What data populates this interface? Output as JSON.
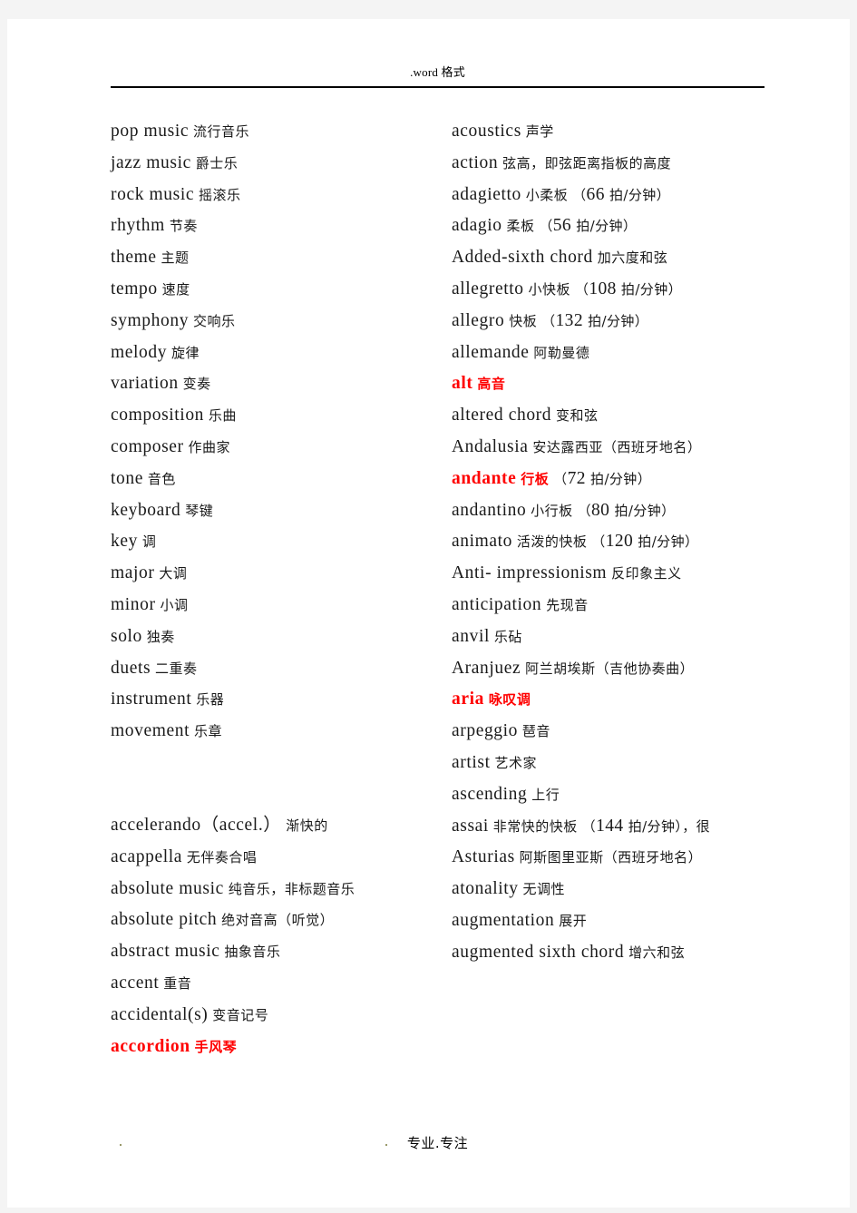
{
  "header": {
    "text": ".word 格式"
  },
  "footer": {
    "text": "专业.专注"
  },
  "colors": {
    "text": "#1a1a1a",
    "highlight": "#ff0000",
    "page_background": "#ffffff",
    "canvas_background": "#f4f4f4",
    "rule": "#000000"
  },
  "columns": {
    "left": {
      "group_one": [
        {
          "term": "pop music",
          "gloss": "流行音乐",
          "red": false
        },
        {
          "term": "jazz music",
          "gloss": "爵士乐",
          "red": false
        },
        {
          "term": "rock music",
          "gloss": "摇滚乐",
          "red": false
        },
        {
          "term": "rhythm",
          "gloss": "节奏",
          "red": false
        },
        {
          "term": "theme",
          "gloss": "主题",
          "red": false
        },
        {
          "term": "tempo",
          "gloss": "速度",
          "red": false
        },
        {
          "term": "symphony",
          "gloss": "交响乐",
          "red": false
        },
        {
          "term": "melody",
          "gloss": "旋律",
          "red": false
        },
        {
          "term": "variation",
          "gloss": "变奏",
          "red": false
        },
        {
          "term": "composition",
          "gloss": "乐曲",
          "red": false
        },
        {
          "term": "composer",
          "gloss": "作曲家",
          "red": false
        },
        {
          "term": "tone",
          "gloss": "音色",
          "red": false
        },
        {
          "term": "keyboard",
          "gloss": "琴键",
          "red": false
        },
        {
          "term": "key",
          "gloss": "调",
          "red": false
        },
        {
          "term": "major",
          "gloss": "大调",
          "red": false
        },
        {
          "term": "minor",
          "gloss": "小调",
          "red": false
        },
        {
          "term": "solo",
          "gloss": "独奏",
          "red": false
        },
        {
          "term": "duets",
          "gloss": "二重奏",
          "red": false
        },
        {
          "term": "instrument",
          "gloss": "乐器",
          "red": false
        },
        {
          "term": "movement",
          "gloss": "乐章",
          "red": false
        }
      ],
      "group_two": [
        {
          "term": "accelerando（accel.）",
          "gloss": "渐快的",
          "red": false
        },
        {
          "term": "acappella",
          "gloss": "无伴奏合唱",
          "red": false
        },
        {
          "term": "absolute music",
          "gloss": "纯音乐，非标题音乐",
          "red": false
        },
        {
          "term": "absolute pitch",
          "gloss": "绝对音高（听觉）",
          "red": false
        },
        {
          "term": "abstract music",
          "gloss": "抽象音乐",
          "red": false
        },
        {
          "term": "accent",
          "gloss": "重音",
          "red": false
        },
        {
          "term": "accidental(s)",
          "gloss": "变音记号",
          "red": false
        },
        {
          "term": "accordion",
          "gloss": "手风琴",
          "red": true
        }
      ]
    },
    "right": {
      "entries": [
        {
          "term": "acoustics",
          "gloss": "声学",
          "red": false,
          "tail": ""
        },
        {
          "term": "action",
          "gloss": "弦高，即弦距离指板的高度",
          "red": false,
          "tail": ""
        },
        {
          "term": "adagietto",
          "gloss": "小柔板",
          "red": false,
          "tail": "（66 拍/分钟）"
        },
        {
          "term": "adagio",
          "gloss": "柔板",
          "red": false,
          "tail": "（56 拍/分钟）"
        },
        {
          "term": "Added-sixth chord",
          "gloss": "加六度和弦",
          "red": false,
          "tail": ""
        },
        {
          "term": "allegretto",
          "gloss": "小快板",
          "red": false,
          "tail": "（108 拍/分钟）"
        },
        {
          "term": "allegro",
          "gloss": "快板",
          "red": false,
          "tail": "（132 拍/分钟）"
        },
        {
          "term": "allemande",
          "gloss": "阿勒曼德",
          "red": false,
          "tail": ""
        },
        {
          "term": "alt",
          "gloss": "高音",
          "red": true,
          "tail": ""
        },
        {
          "term": "altered chord",
          "gloss": "变和弦",
          "red": false,
          "tail": ""
        },
        {
          "term": "Andalusia",
          "gloss": "安达露西亚（西班牙地名）",
          "red": false,
          "tail": ""
        },
        {
          "term": "andante",
          "gloss": "行板",
          "red": true,
          "tail": "（72 拍/分钟）"
        },
        {
          "term": "andantino",
          "gloss": "小行板",
          "red": false,
          "tail": "（80 拍/分钟）"
        },
        {
          "term": "animato",
          "gloss": "活泼的快板",
          "red": false,
          "tail": "（120 拍/分钟）"
        },
        {
          "term": "Anti- impressionism",
          "gloss": "反印象主义",
          "red": false,
          "tail": ""
        },
        {
          "term": "anticipation",
          "gloss": "先现音",
          "red": false,
          "tail": ""
        },
        {
          "term": "anvil",
          "gloss": "乐砧",
          "red": false,
          "tail": ""
        },
        {
          "term": "Aranjuez",
          "gloss": "阿兰胡埃斯（吉他协奏曲）",
          "red": false,
          "tail": ""
        },
        {
          "term": "aria",
          "gloss": "咏叹调",
          "red": true,
          "tail": ""
        },
        {
          "term": "arpeggio",
          "gloss": "琶音",
          "red": false,
          "tail": ""
        },
        {
          "term": "artist",
          "gloss": "艺术家",
          "red": false,
          "tail": ""
        },
        {
          "term": "ascending",
          "gloss": "上行",
          "red": false,
          "tail": ""
        },
        {
          "term": "assai",
          "gloss": "非常快的快板",
          "red": false,
          "tail": "（144 拍/分钟），很"
        },
        {
          "term": "Asturias",
          "gloss": "阿斯图里亚斯（西班牙地名）",
          "red": false,
          "tail": ""
        },
        {
          "term": "atonality",
          "gloss": "无调性",
          "red": false,
          "tail": ""
        },
        {
          "term": "augmentation",
          "gloss": "展开",
          "red": false,
          "tail": ""
        },
        {
          "term": "augmented sixth chord",
          "gloss": "增六和弦",
          "red": false,
          "tail": ""
        }
      ]
    }
  }
}
